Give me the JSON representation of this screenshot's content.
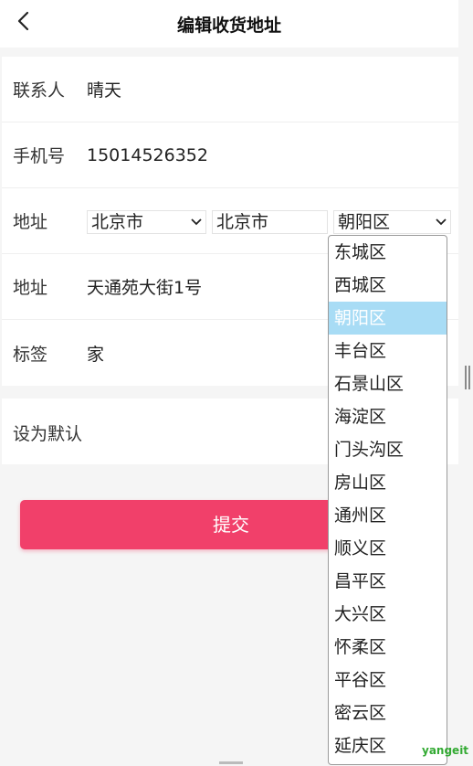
{
  "header": {
    "title": "编辑收货地址"
  },
  "form": {
    "contact": {
      "label": "联系人",
      "value": "晴天"
    },
    "phone": {
      "label": "手机号",
      "value": "15014526352"
    },
    "region": {
      "label": "地址",
      "province": "北京市",
      "city": "北京市",
      "district": "朝阳区"
    },
    "address": {
      "label": "地址",
      "value": "天通苑大街1号"
    },
    "tag": {
      "label": "标签",
      "value": "家"
    }
  },
  "default_setting": {
    "label": "设为默认"
  },
  "submit": {
    "label": "提交"
  },
  "district_dropdown": {
    "selected_index": 2,
    "options": [
      "东城区",
      "西城区",
      "朝阳区",
      "丰台区",
      "石景山区",
      "海淀区",
      "门头沟区",
      "房山区",
      "通州区",
      "顺义区",
      "昌平区",
      "大兴区",
      "怀柔区",
      "平谷区",
      "密云区",
      "延庆区"
    ]
  },
  "watermark": "yangeit",
  "colors": {
    "accent": "#f1406a",
    "selected_option": "#a8dcf5"
  }
}
